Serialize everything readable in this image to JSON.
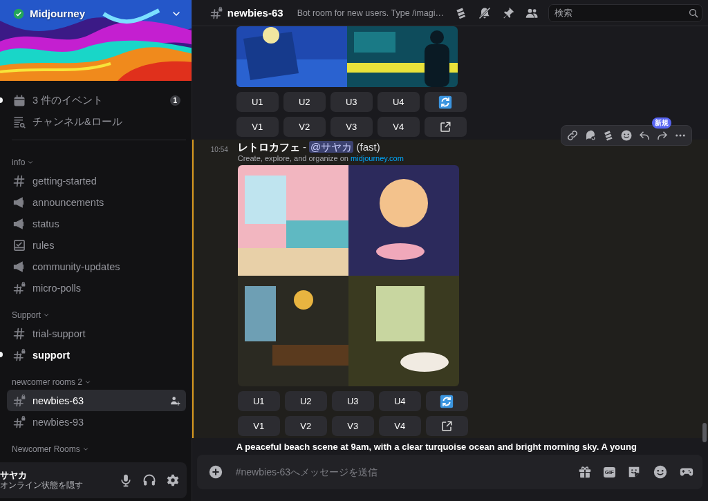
{
  "server": {
    "name": "Midjourney",
    "verified": true
  },
  "sidebar": {
    "top_items": [
      {
        "kind": "events",
        "label": "3 件のイベント",
        "badge": "1",
        "unread": true
      },
      {
        "kind": "browse",
        "label": "チャンネル&ロール",
        "unread": false
      }
    ],
    "categories": [
      {
        "name": "info",
        "channels": [
          {
            "name": "getting-started",
            "kind": "text",
            "selected": false,
            "unread": false
          },
          {
            "name": "announcements",
            "kind": "announcement",
            "selected": false,
            "unread": false
          },
          {
            "name": "status",
            "kind": "announcement",
            "selected": false,
            "unread": false
          },
          {
            "name": "rules",
            "kind": "rules",
            "selected": false,
            "unread": false
          },
          {
            "name": "community-updates",
            "kind": "announcement",
            "selected": false,
            "unread": false
          },
          {
            "name": "micro-polls",
            "kind": "private",
            "selected": false,
            "unread": false
          }
        ]
      },
      {
        "name": "Support",
        "channels": [
          {
            "name": "trial-support",
            "kind": "text",
            "selected": false,
            "unread": false
          },
          {
            "name": "support",
            "kind": "private",
            "selected": false,
            "unread": true
          }
        ]
      },
      {
        "name": "newcomer rooms 2",
        "channels": [
          {
            "name": "newbies-63",
            "kind": "private",
            "selected": true,
            "unread": false
          },
          {
            "name": "newbies-93",
            "kind": "private",
            "selected": false,
            "unread": false
          }
        ]
      },
      {
        "name": "Newcomer Rooms"
      }
    ]
  },
  "user": {
    "name": "サヤカ",
    "status": "オンライン状態を隠す"
  },
  "header": {
    "channel": "newbies-63",
    "topic": "Bot room for new users. Type /imagi…",
    "search": {
      "placeholder": "検索"
    }
  },
  "messages": [
    {
      "kind": "image-result",
      "cut_at_top": true,
      "highlighted": false,
      "buttons": [
        [
          {
            "kind": "text",
            "label": "U1"
          },
          {
            "kind": "text",
            "label": "U2"
          },
          {
            "kind": "text",
            "label": "U3"
          },
          {
            "kind": "text",
            "label": "U4"
          },
          {
            "kind": "refresh"
          }
        ],
        [
          {
            "kind": "text",
            "label": "V1"
          },
          {
            "kind": "text",
            "label": "V2"
          },
          {
            "kind": "text",
            "label": "V3"
          },
          {
            "kind": "text",
            "label": "V4"
          },
          {
            "kind": "open"
          }
        ]
      ]
    },
    {
      "kind": "image-result",
      "cut_at_top": false,
      "highlighted": true,
      "time": "10:54",
      "title": "レトロカフェ",
      "separator": " - ",
      "mention": "@サヤカ",
      "speed": "(fast)",
      "subtitle": "Create, explore, and organize on ",
      "link": "midjourney.com",
      "hover_badge": "新規",
      "buttons": [
        [
          {
            "kind": "text",
            "label": "U1"
          },
          {
            "kind": "text",
            "label": "U2"
          },
          {
            "kind": "text",
            "label": "U3"
          },
          {
            "kind": "text",
            "label": "U4"
          },
          {
            "kind": "refresh"
          }
        ],
        [
          {
            "kind": "text",
            "label": "V1"
          },
          {
            "kind": "text",
            "label": "V2"
          },
          {
            "kind": "text",
            "label": "V3"
          },
          {
            "kind": "text",
            "label": "V4"
          },
          {
            "kind": "open"
          }
        ]
      ]
    },
    {
      "kind": "text",
      "highlighted": false,
      "text": "A peaceful beach scene at 9am, with a clear turquoise ocean and bright morning sky. A young"
    }
  ],
  "composer": {
    "placeholder": "#newbies-63へメッセージを送信",
    "gif_label": "GIF"
  }
}
